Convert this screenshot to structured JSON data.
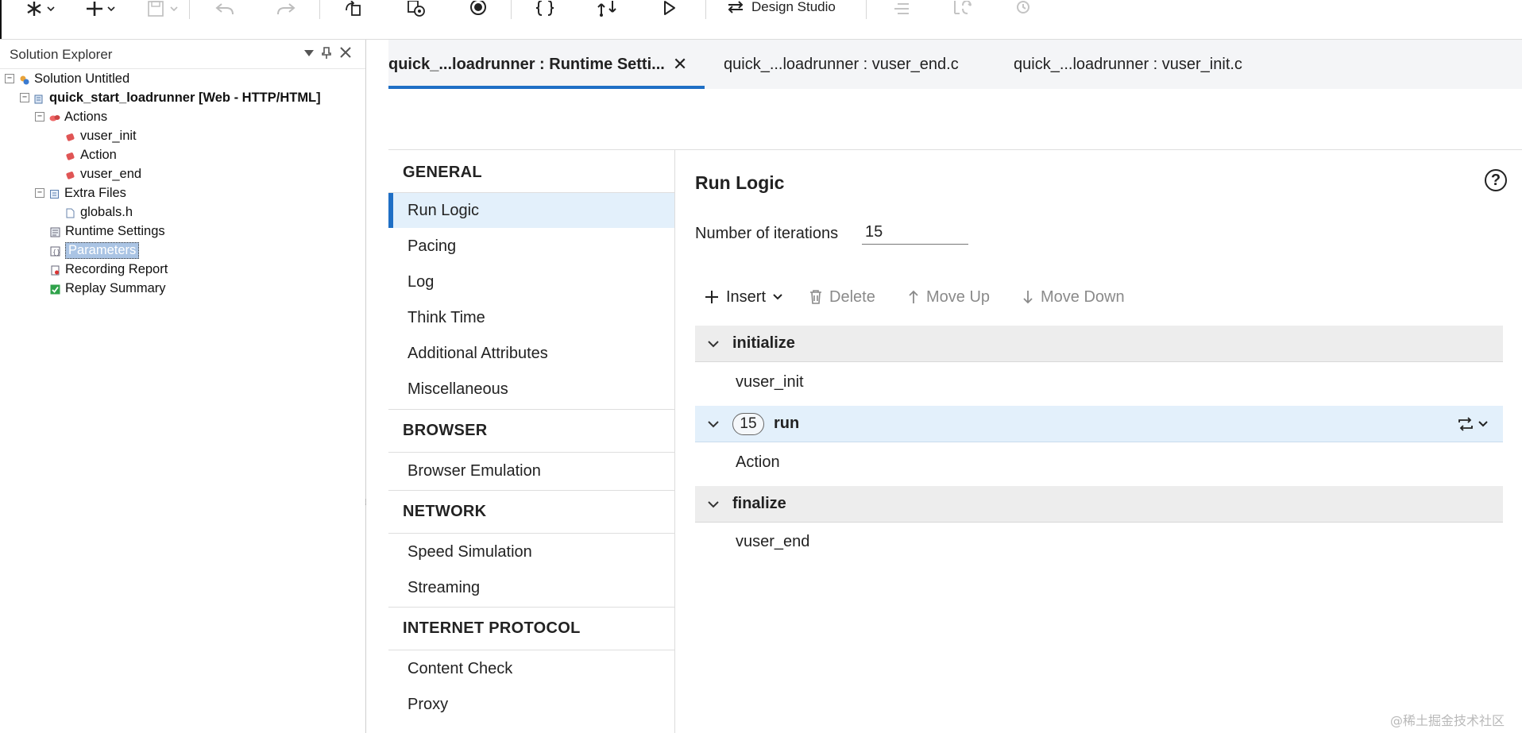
{
  "toolbar": {
    "design_studio_label": "Design Studio",
    "buttons": [
      "new-solution",
      "add",
      "save",
      "undo",
      "redo",
      "refresh",
      "record",
      "stop-record",
      "code-braces",
      "compile",
      "replay",
      "design-studio",
      "align",
      "dis-1",
      "dis-2"
    ]
  },
  "solution_explorer": {
    "title": "Solution Explorer",
    "items": [
      {
        "label": "Solution Untitled"
      },
      {
        "label": "quick_start_loadrunner [Web - HTTP/HTML]"
      },
      {
        "label": "Actions"
      },
      {
        "label": "vuser_init"
      },
      {
        "label": "Action"
      },
      {
        "label": "vuser_end"
      },
      {
        "label": "Extra Files"
      },
      {
        "label": "globals.h"
      },
      {
        "label": "Runtime Settings"
      },
      {
        "label": "Parameters"
      },
      {
        "label": "Recording Report"
      },
      {
        "label": "Replay Summary"
      }
    ]
  },
  "tabs": [
    {
      "label": "quick_...loadrunner : Runtime Setti...",
      "active": true
    },
    {
      "label": "quick_...loadrunner : vuser_end.c",
      "active": false
    },
    {
      "label": "quick_...loadrunner : vuser_init.c",
      "active": false
    }
  ],
  "runtime_nav": {
    "sections": [
      {
        "title": "GENERAL",
        "items": [
          "Run Logic",
          "Pacing",
          "Log",
          "Think Time",
          "Additional Attributes",
          "Miscellaneous"
        ]
      },
      {
        "title": "BROWSER",
        "items": [
          "Browser Emulation"
        ]
      },
      {
        "title": "NETWORK",
        "items": [
          "Speed Simulation",
          "Streaming"
        ]
      },
      {
        "title": "INTERNET PROTOCOL",
        "items": [
          "Content Check",
          "Proxy"
        ]
      }
    ],
    "selected": "Run Logic"
  },
  "run_logic": {
    "title": "Run Logic",
    "iterations_label": "Number of iterations",
    "iterations_value": "15",
    "actions": {
      "insert": "Insert",
      "delete": "Delete",
      "move_up": "Move Up",
      "move_down": "Move Down"
    },
    "groups": [
      {
        "name": "initialize",
        "step": "vuser_init"
      },
      {
        "name": "run",
        "count": "15",
        "step": "Action"
      },
      {
        "name": "finalize",
        "step": "vuser_end"
      }
    ]
  },
  "watermark": "@稀土掘金技术社区",
  "colors": {
    "accent": "#1f6fc5",
    "selected_bg": "#e3f0fb"
  }
}
